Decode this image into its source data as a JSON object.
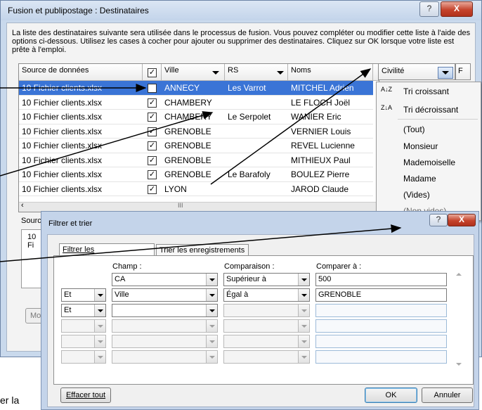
{
  "window": {
    "title": "Fusion et publipostage : Destinataires",
    "help_label": "?",
    "close_label": "X",
    "description": "La liste des destinataires suivante sera utilisée dans le processus de fusion. Vous pouvez compléter ou modifier cette liste à l'aide des options ci-dessous. Utilisez les cases à cocher pour ajouter ou supprimer des destinataires. Cliquez sur OK lorsque votre liste est prête à l'emploi."
  },
  "grid": {
    "headers": {
      "source": "Source de données",
      "ville": "Ville",
      "rs": "RS",
      "noms": "Noms",
      "civilite": "Civilité",
      "extra": "F"
    },
    "rows": [
      {
        "source": "10 Fichier clients.xlsx",
        "checked": "✓",
        "ville": "ANNECY",
        "rs": "Les Varrot",
        "nom": "MITCHEL Adrien"
      },
      {
        "source": "10 Fichier clients.xlsx",
        "checked": "✓",
        "ville": "CHAMBERY",
        "rs": "",
        "nom": "LE FLOCH Joël"
      },
      {
        "source": "10 Fichier clients.xlsx",
        "checked": "✓",
        "ville": "CHAMBERY",
        "rs": "Le Serpolet",
        "nom": "WANIER Eric"
      },
      {
        "source": "10 Fichier clients.xlsx",
        "checked": "✓",
        "ville": "GRENOBLE",
        "rs": "",
        "nom": "VERNIER Louis"
      },
      {
        "source": "10 Fichier clients.xlsx",
        "checked": "✓",
        "ville": "GRENOBLE",
        "rs": "",
        "nom": "REVEL Lucienne"
      },
      {
        "source": "10 Fichier clients.xlsx",
        "checked": "✓",
        "ville": "GRENOBLE",
        "rs": "",
        "nom": "MITHIEUX Paul"
      },
      {
        "source": "10 Fichier clients.xlsx",
        "checked": "✓",
        "ville": "GRENOBLE",
        "rs": "Le Barafoly",
        "nom": "BOULEZ Pierre"
      },
      {
        "source": "10 Fichier clients.xlsx",
        "checked": "✓",
        "ville": "LYON",
        "rs": "",
        "nom": "JAROD Claude"
      }
    ],
    "scroll_left": "‹",
    "scroll_thumb": "III"
  },
  "sort_menu": {
    "asc_icon": "A↓Z",
    "asc": "Tri croissant",
    "desc_icon": "Z↓A",
    "desc": "Tri décroissant",
    "all": "(Tout)",
    "opt1": "Monsieur",
    "opt2": "Mademoiselle",
    "opt3": "Madame",
    "empty": "(Vides)",
    "nonempty": "(Non vides)"
  },
  "background": {
    "source_label": "Source",
    "list_item": "10 Fi",
    "mod_button": "Mod",
    "fragment": "er la"
  },
  "filter_dialog": {
    "title": "Filtrer et trier",
    "tab_filter": "Filtrer les enregistrements",
    "tab_sort": "Trier les enregistrements",
    "col_field": "Champ :",
    "col_comparison": "Comparaison :",
    "col_compare_to": "Comparer à :",
    "rows": [
      {
        "op": "",
        "field": "CA",
        "comparison": "Supérieur à",
        "value": "500"
      },
      {
        "op": "Et",
        "field": "Ville",
        "comparison": "Égal à",
        "value": "GRENOBLE"
      },
      {
        "op": "Et",
        "field": "",
        "comparison": "",
        "value": ""
      },
      {
        "op": "",
        "field": "",
        "comparison": "",
        "value": ""
      },
      {
        "op": "",
        "field": "",
        "comparison": "",
        "value": ""
      },
      {
        "op": "",
        "field": "",
        "comparison": "",
        "value": ""
      }
    ],
    "clear_button": "Effacer tout",
    "ok_button": "OK",
    "cancel_button": "Annuler"
  },
  "colors": {
    "selection": "#3a74d6",
    "window_frame": "#c9d9ec",
    "arrow": "#000000"
  }
}
